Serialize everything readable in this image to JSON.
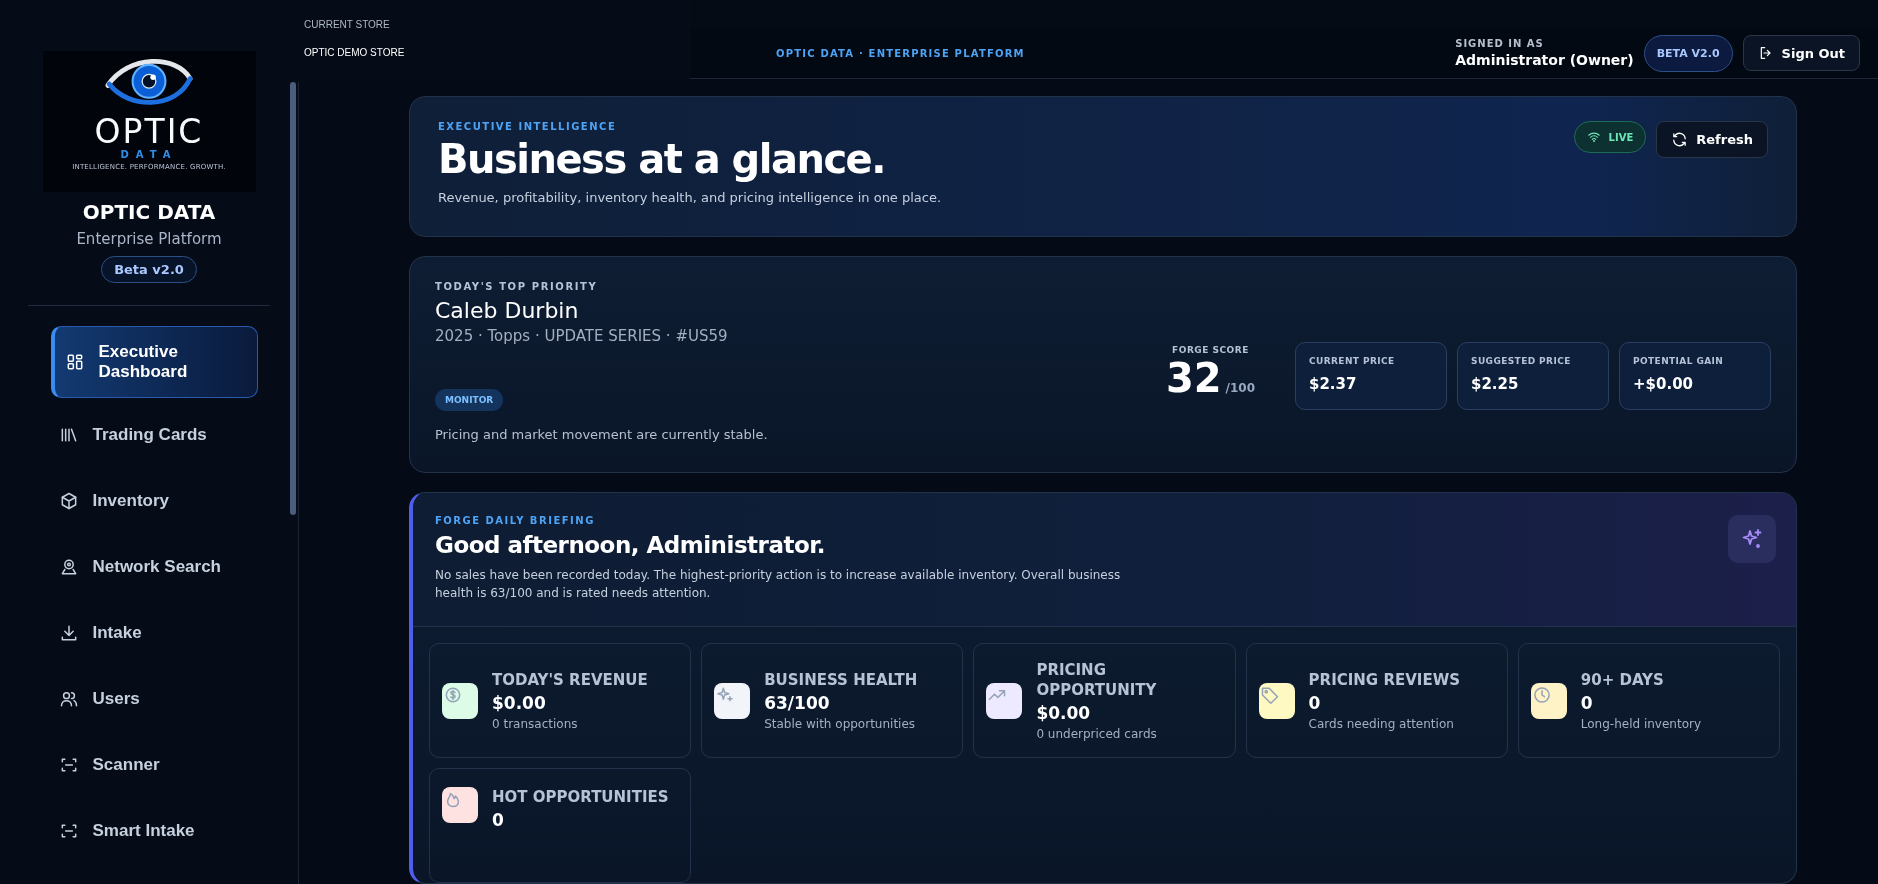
{
  "store_menu": {
    "label": "CURRENT STORE",
    "store": "OPTIC DEMO STORE"
  },
  "sidebar": {
    "logo": {
      "wordmark": "OPTIC",
      "sub": "DATA",
      "tagline": "INTELLIGENCE. PERFORMANCE. GROWTH."
    },
    "title": "OPTIC DATA",
    "subtitle": "Enterprise Platform",
    "badge": "Beta v2.0",
    "items": [
      {
        "label": "Executive Dashboard",
        "selected": true
      },
      {
        "label": "Trading Cards",
        "selected": false
      },
      {
        "label": "Inventory",
        "selected": false
      },
      {
        "label": "Network Search",
        "selected": false
      },
      {
        "label": "Intake",
        "selected": false
      },
      {
        "label": "Users",
        "selected": false
      },
      {
        "label": "Scanner",
        "selected": false
      },
      {
        "label": "Smart Intake",
        "selected": false
      }
    ]
  },
  "header": {
    "tagline": "OPTIC DATA · ENTERPRISE PLATFORM",
    "signed_in_label": "SIGNED IN AS",
    "user": "Administrator (Owner)",
    "badge": "BETA V2.0",
    "sign_out": "Sign Out"
  },
  "hero": {
    "eyebrow": "EXECUTIVE INTELLIGENCE",
    "title": "Business at a glance.",
    "subtitle": "Revenue, profitability, inventory health, and pricing intelligence in one place.",
    "live": "LIVE",
    "refresh": "Refresh"
  },
  "priority": {
    "eyebrow": "TODAY'S TOP PRIORITY",
    "name": "Caleb Durbin",
    "details": "2025 · Topps · UPDATE SERIES · #US59",
    "tag": "MONITOR",
    "note": "Pricing and market movement are currently stable.",
    "score_label": "FORGE SCORE",
    "score": "32",
    "score_max": "/100",
    "prices": [
      {
        "label": "CURRENT PRICE",
        "value": "$2.37"
      },
      {
        "label": "SUGGESTED PRICE",
        "value": "$2.25"
      },
      {
        "label": "POTENTIAL GAIN",
        "value": "+$0.00"
      }
    ]
  },
  "briefing": {
    "eyebrow": "FORGE DAILY BRIEFING",
    "title": "Good afternoon, Administrator.",
    "text": "No sales have been recorded today. The highest-priority action is to increase available inventory. Overall business health is 63/100 and is rated needs attention.",
    "stats": [
      {
        "label": "TODAY'S REVENUE",
        "value": "$0.00",
        "note": "0 transactions",
        "color": "#dcfce7"
      },
      {
        "label": "BUSINESS HEALTH",
        "value": "63/100",
        "note": "Stable with opportunities",
        "color": "#f1f5f9"
      },
      {
        "label": "PRICING OPPORTUNITY",
        "value": "$0.00",
        "note": "0 underpriced cards",
        "color": "#ede9fe"
      },
      {
        "label": "PRICING REVIEWS",
        "value": "0",
        "note": "Cards needing attention",
        "color": "#fef9c3"
      },
      {
        "label": "90+ DAYS",
        "value": "0",
        "note": "Long-held inventory",
        "color": "#fef3c7"
      },
      {
        "label": "HOT OPPORTUNITIES",
        "value": "0",
        "color": "#fee2e2"
      }
    ]
  }
}
